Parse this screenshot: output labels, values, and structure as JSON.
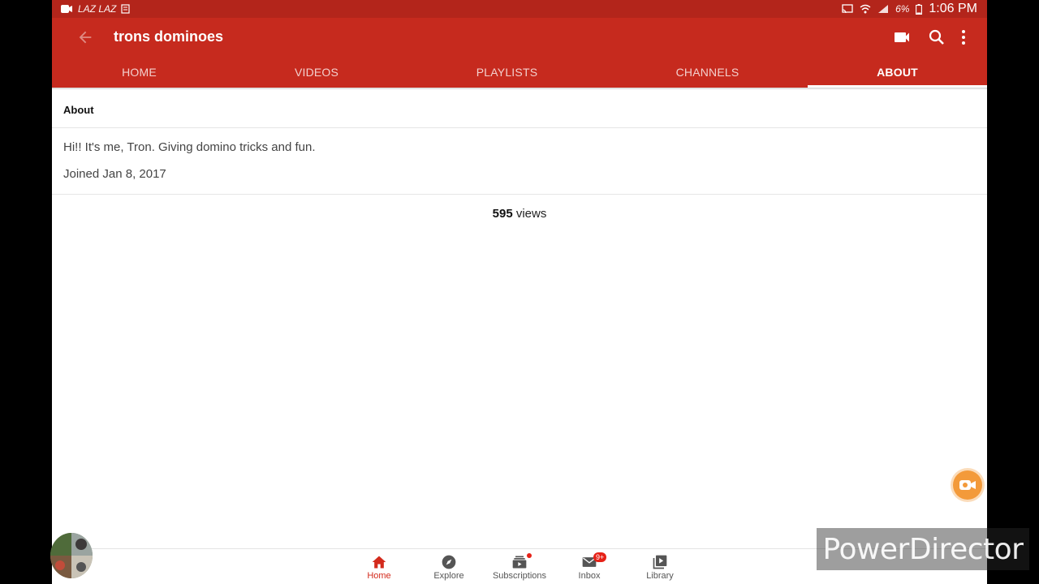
{
  "status_bar": {
    "left_text": "LAZ LAZ",
    "battery": "6%",
    "time": "1:06 PM"
  },
  "app_bar": {
    "title": "trons dominoes",
    "icons": [
      "back-arrow-icon",
      "video-camera-icon",
      "search-icon",
      "more-vert-icon"
    ]
  },
  "tabs": [
    {
      "label": "HOME",
      "active": false
    },
    {
      "label": "VIDEOS",
      "active": false
    },
    {
      "label": "PLAYLISTS",
      "active": false
    },
    {
      "label": "CHANNELS",
      "active": false
    },
    {
      "label": "ABOUT",
      "active": true
    }
  ],
  "about": {
    "header": "About",
    "description": "Hi!! It's me, Tron. Giving domino tricks and fun.",
    "joined": "Joined Jan 8, 2017",
    "views_count": "595",
    "views_label": "views"
  },
  "bottom_nav": [
    {
      "label": "Home",
      "icon": "home-icon",
      "active": true
    },
    {
      "label": "Explore",
      "icon": "compass-icon",
      "active": false
    },
    {
      "label": "Subscriptions",
      "icon": "subscriptions-icon",
      "active": false,
      "dot": true
    },
    {
      "label": "Inbox",
      "icon": "mail-icon",
      "active": false,
      "badge": "9+"
    },
    {
      "label": "Library",
      "icon": "library-icon",
      "active": false
    }
  ],
  "watermark": "PowerDirector",
  "colors": {
    "status_bar": "#b3251b",
    "app_bar": "#c62a1e",
    "active_nav": "#d32a1c",
    "fab": "#f39a3a"
  }
}
